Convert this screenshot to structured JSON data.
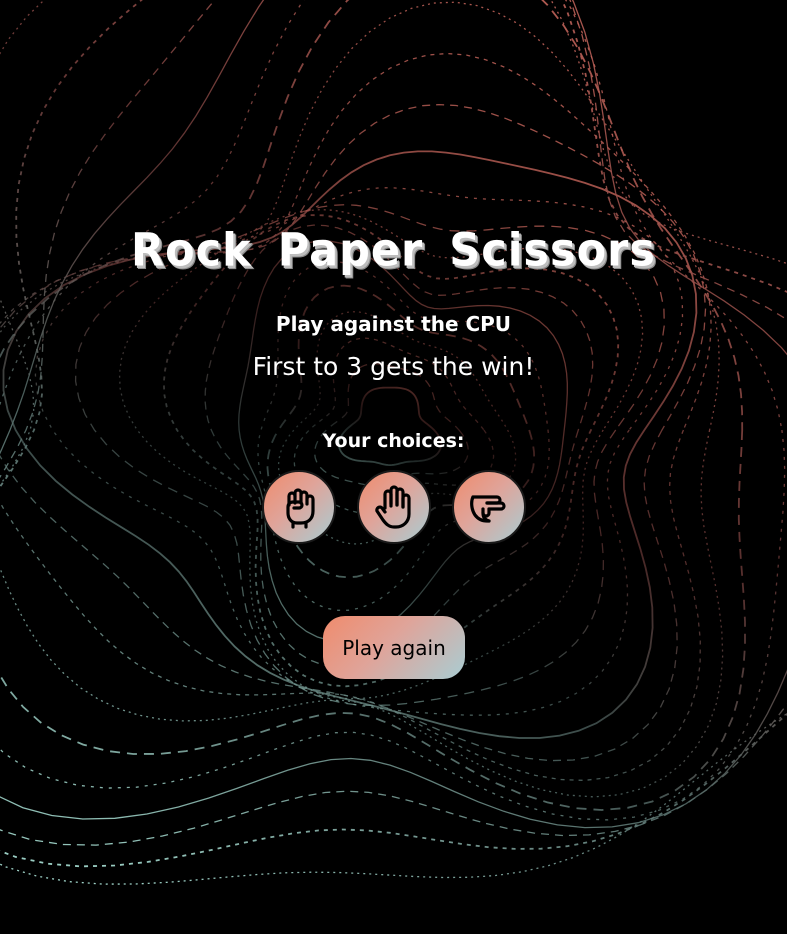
{
  "header": {
    "title": "Rock Paper Scissors",
    "subtitle": "Play against the CPU",
    "rule": "First to 3 gets the win!"
  },
  "choices": {
    "label": "Your choices:",
    "items": [
      {
        "name": "rock",
        "icon": "fist-icon"
      },
      {
        "name": "paper",
        "icon": "open-hand-icon"
      },
      {
        "name": "scissors",
        "icon": "scissors-hand-icon"
      }
    ]
  },
  "actions": {
    "play_again_label": "Play again"
  },
  "theme": {
    "background": "#000000",
    "gradient_start": "#f08b6c",
    "gradient_mid": "#dfa49a",
    "gradient_end": "#a9cdd3",
    "line_warm": "#e8766a",
    "line_cool": "#9fd4cc"
  }
}
